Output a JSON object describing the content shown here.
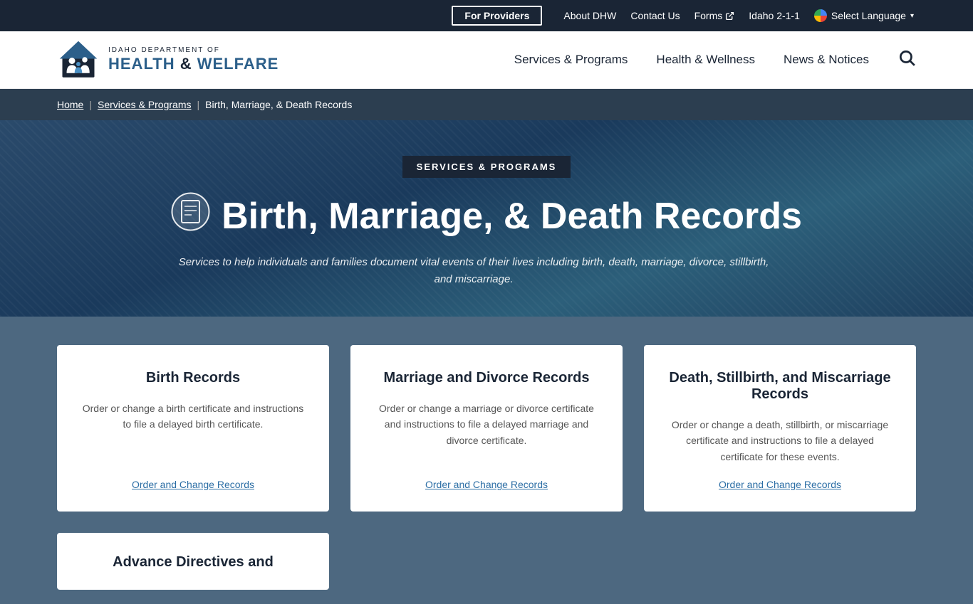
{
  "topbar": {
    "for_providers": "For Providers",
    "about": "About DHW",
    "contact": "Contact Us",
    "forms": "Forms",
    "idaho211": "Idaho 2-1-1",
    "select_language": "Select Language"
  },
  "header": {
    "logo_dept": "IDAHO DEPARTMENT OF",
    "logo_name_part1": "HEALTH",
    "logo_name_sep": " & ",
    "logo_name_part2": "WELFARE",
    "nav": {
      "services": "Services & Programs",
      "health": "Health & Wellness",
      "news": "News & Notices"
    }
  },
  "breadcrumb": {
    "home": "Home",
    "services": "Services & Programs",
    "current": "Birth, Marriage, & Death Records"
  },
  "hero": {
    "badge": "SERVICES & PROGRAMS",
    "title": "Birth, Marriage, & Death Records",
    "subtitle": "Services to help individuals and families document vital events of their lives including birth, death, marriage, divorce, stillbirth, and miscarriage."
  },
  "cards": [
    {
      "title": "Birth Records",
      "description": "Order or change a birth certificate and instructions to file a delayed birth certificate.",
      "link": "Order and Change Records"
    },
    {
      "title": "Marriage and Divorce Records",
      "description": "Order or change a marriage or divorce certificate and instructions to file a delayed marriage and divorce certificate.",
      "link": "Order and Change Records"
    },
    {
      "title": "Death, Stillbirth, and Miscarriage Records",
      "description": "Order or change a death, stillbirth, or miscarriage certificate and instructions to file a delayed certificate for these events.",
      "link": "Order and Change Records"
    }
  ],
  "partial_card": {
    "title": "Advance Directives and"
  }
}
